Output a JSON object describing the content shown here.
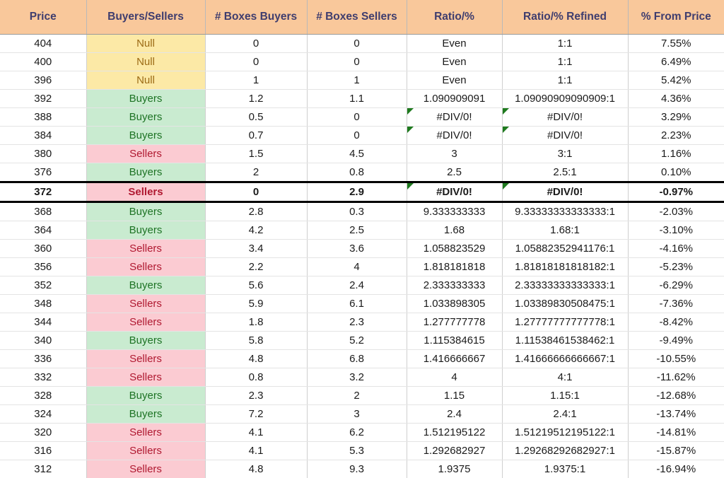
{
  "table": {
    "columns": [
      "Price",
      "Buyers/Sellers",
      "# Boxes Buyers",
      "# Boxes Sellers",
      "Ratio/%",
      "Ratio/% Refined",
      "% From Price"
    ],
    "colors": {
      "header_bg": "#F9C89B",
      "header_text": "#3F3D6E",
      "null_bg": "#FCE9A6",
      "null_text": "#9C6B15",
      "buyers_bg": "#C9EBD0",
      "buyers_text": "#1D7324",
      "sellers_bg": "#FBCBD2",
      "sellers_text": "#B01931",
      "error_flag": "#1E7A1E",
      "highlight_border": "#000000"
    },
    "rows": [
      {
        "price": "404",
        "category": "Null",
        "boxes_buyers": "0",
        "boxes_sellers": "0",
        "ratio": "Even",
        "ratio_refined": "1:1",
        "pct_from_price": "7.55%",
        "cat_class": "cat-null",
        "ratio_error": false,
        "refined_error": false,
        "highlight": false
      },
      {
        "price": "400",
        "category": "Null",
        "boxes_buyers": "0",
        "boxes_sellers": "0",
        "ratio": "Even",
        "ratio_refined": "1:1",
        "pct_from_price": "6.49%",
        "cat_class": "cat-null",
        "ratio_error": false,
        "refined_error": false,
        "highlight": false
      },
      {
        "price": "396",
        "category": "Null",
        "boxes_buyers": "1",
        "boxes_sellers": "1",
        "ratio": "Even",
        "ratio_refined": "1:1",
        "pct_from_price": "5.42%",
        "cat_class": "cat-null",
        "ratio_error": false,
        "refined_error": false,
        "highlight": false
      },
      {
        "price": "392",
        "category": "Buyers",
        "boxes_buyers": "1.2",
        "boxes_sellers": "1.1",
        "ratio": "1.090909091",
        "ratio_refined": "1.09090909090909:1",
        "pct_from_price": "4.36%",
        "cat_class": "cat-buyers",
        "ratio_error": false,
        "refined_error": false,
        "highlight": false
      },
      {
        "price": "388",
        "category": "Buyers",
        "boxes_buyers": "0.5",
        "boxes_sellers": "0",
        "ratio": "#DIV/0!",
        "ratio_refined": "#DIV/0!",
        "pct_from_price": "3.29%",
        "cat_class": "cat-buyers",
        "ratio_error": true,
        "refined_error": true,
        "highlight": false
      },
      {
        "price": "384",
        "category": "Buyers",
        "boxes_buyers": "0.7",
        "boxes_sellers": "0",
        "ratio": "#DIV/0!",
        "ratio_refined": "#DIV/0!",
        "pct_from_price": "2.23%",
        "cat_class": "cat-buyers",
        "ratio_error": true,
        "refined_error": true,
        "highlight": false
      },
      {
        "price": "380",
        "category": "Sellers",
        "boxes_buyers": "1.5",
        "boxes_sellers": "4.5",
        "ratio": "3",
        "ratio_refined": "3:1",
        "pct_from_price": "1.16%",
        "cat_class": "cat-sellers",
        "ratio_error": false,
        "refined_error": false,
        "highlight": false
      },
      {
        "price": "376",
        "category": "Buyers",
        "boxes_buyers": "2",
        "boxes_sellers": "0.8",
        "ratio": "2.5",
        "ratio_refined": "2.5:1",
        "pct_from_price": "0.10%",
        "cat_class": "cat-buyers",
        "ratio_error": false,
        "refined_error": false,
        "highlight": false
      },
      {
        "price": "372",
        "category": "Sellers",
        "boxes_buyers": "0",
        "boxes_sellers": "2.9",
        "ratio": "#DIV/0!",
        "ratio_refined": "#DIV/0!",
        "pct_from_price": "-0.97%",
        "cat_class": "cat-sellers",
        "ratio_error": true,
        "refined_error": true,
        "highlight": true
      },
      {
        "price": "368",
        "category": "Buyers",
        "boxes_buyers": "2.8",
        "boxes_sellers": "0.3",
        "ratio": "9.333333333",
        "ratio_refined": "9.33333333333333:1",
        "pct_from_price": "-2.03%",
        "cat_class": "cat-buyers",
        "ratio_error": false,
        "refined_error": false,
        "highlight": false
      },
      {
        "price": "364",
        "category": "Buyers",
        "boxes_buyers": "4.2",
        "boxes_sellers": "2.5",
        "ratio": "1.68",
        "ratio_refined": "1.68:1",
        "pct_from_price": "-3.10%",
        "cat_class": "cat-buyers",
        "ratio_error": false,
        "refined_error": false,
        "highlight": false
      },
      {
        "price": "360",
        "category": "Sellers",
        "boxes_buyers": "3.4",
        "boxes_sellers": "3.6",
        "ratio": "1.058823529",
        "ratio_refined": "1.05882352941176:1",
        "pct_from_price": "-4.16%",
        "cat_class": "cat-sellers",
        "ratio_error": false,
        "refined_error": false,
        "highlight": false
      },
      {
        "price": "356",
        "category": "Sellers",
        "boxes_buyers": "2.2",
        "boxes_sellers": "4",
        "ratio": "1.818181818",
        "ratio_refined": "1.81818181818182:1",
        "pct_from_price": "-5.23%",
        "cat_class": "cat-sellers",
        "ratio_error": false,
        "refined_error": false,
        "highlight": false
      },
      {
        "price": "352",
        "category": "Buyers",
        "boxes_buyers": "5.6",
        "boxes_sellers": "2.4",
        "ratio": "2.333333333",
        "ratio_refined": "2.33333333333333:1",
        "pct_from_price": "-6.29%",
        "cat_class": "cat-buyers",
        "ratio_error": false,
        "refined_error": false,
        "highlight": false
      },
      {
        "price": "348",
        "category": "Sellers",
        "boxes_buyers": "5.9",
        "boxes_sellers": "6.1",
        "ratio": "1.033898305",
        "ratio_refined": "1.03389830508475:1",
        "pct_from_price": "-7.36%",
        "cat_class": "cat-sellers",
        "ratio_error": false,
        "refined_error": false,
        "highlight": false
      },
      {
        "price": "344",
        "category": "Sellers",
        "boxes_buyers": "1.8",
        "boxes_sellers": "2.3",
        "ratio": "1.277777778",
        "ratio_refined": "1.27777777777778:1",
        "pct_from_price": "-8.42%",
        "cat_class": "cat-sellers",
        "ratio_error": false,
        "refined_error": false,
        "highlight": false
      },
      {
        "price": "340",
        "category": "Buyers",
        "boxes_buyers": "5.8",
        "boxes_sellers": "5.2",
        "ratio": "1.115384615",
        "ratio_refined": "1.11538461538462:1",
        "pct_from_price": "-9.49%",
        "cat_class": "cat-buyers",
        "ratio_error": false,
        "refined_error": false,
        "highlight": false
      },
      {
        "price": "336",
        "category": "Sellers",
        "boxes_buyers": "4.8",
        "boxes_sellers": "6.8",
        "ratio": "1.416666667",
        "ratio_refined": "1.41666666666667:1",
        "pct_from_price": "-10.55%",
        "cat_class": "cat-sellers",
        "ratio_error": false,
        "refined_error": false,
        "highlight": false
      },
      {
        "price": "332",
        "category": "Sellers",
        "boxes_buyers": "0.8",
        "boxes_sellers": "3.2",
        "ratio": "4",
        "ratio_refined": "4:1",
        "pct_from_price": "-11.62%",
        "cat_class": "cat-sellers",
        "ratio_error": false,
        "refined_error": false,
        "highlight": false
      },
      {
        "price": "328",
        "category": "Buyers",
        "boxes_buyers": "2.3",
        "boxes_sellers": "2",
        "ratio": "1.15",
        "ratio_refined": "1.15:1",
        "pct_from_price": "-12.68%",
        "cat_class": "cat-buyers",
        "ratio_error": false,
        "refined_error": false,
        "highlight": false
      },
      {
        "price": "324",
        "category": "Buyers",
        "boxes_buyers": "7.2",
        "boxes_sellers": "3",
        "ratio": "2.4",
        "ratio_refined": "2.4:1",
        "pct_from_price": "-13.74%",
        "cat_class": "cat-buyers",
        "ratio_error": false,
        "refined_error": false,
        "highlight": false
      },
      {
        "price": "320",
        "category": "Sellers",
        "boxes_buyers": "4.1",
        "boxes_sellers": "6.2",
        "ratio": "1.512195122",
        "ratio_refined": "1.51219512195122:1",
        "pct_from_price": "-14.81%",
        "cat_class": "cat-sellers",
        "ratio_error": false,
        "refined_error": false,
        "highlight": false
      },
      {
        "price": "316",
        "category": "Sellers",
        "boxes_buyers": "4.1",
        "boxes_sellers": "5.3",
        "ratio": "1.292682927",
        "ratio_refined": "1.29268292682927:1",
        "pct_from_price": "-15.87%",
        "cat_class": "cat-sellers",
        "ratio_error": false,
        "refined_error": false,
        "highlight": false
      },
      {
        "price": "312",
        "category": "Sellers",
        "boxes_buyers": "4.8",
        "boxes_sellers": "9.3",
        "ratio": "1.9375",
        "ratio_refined": "1.9375:1",
        "pct_from_price": "-16.94%",
        "cat_class": "cat-sellers",
        "ratio_error": false,
        "refined_error": false,
        "highlight": false
      }
    ]
  }
}
